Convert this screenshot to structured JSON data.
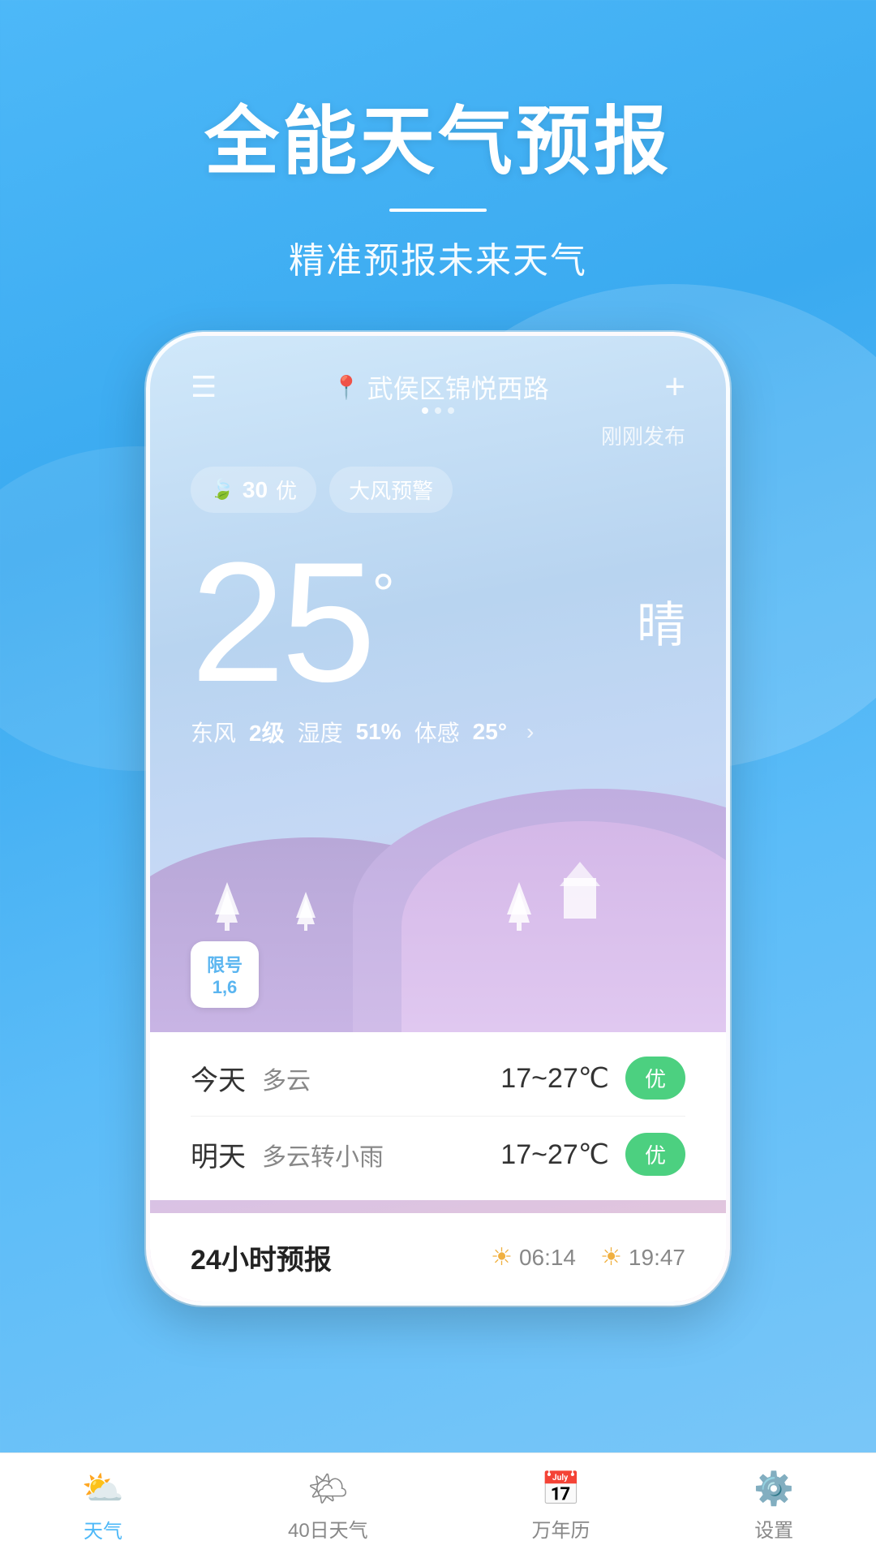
{
  "hero": {
    "title": "全能天气预报",
    "divider": true,
    "subtitle": "精准预报未来天气"
  },
  "phone": {
    "location": "武侯区锦悦西路",
    "published": "刚刚发布",
    "aqi": {
      "number": "30",
      "level": "优"
    },
    "warning": "大风预警",
    "temperature": "25",
    "degree_symbol": "°",
    "condition": "晴",
    "wind": "东风",
    "wind_level": "2级",
    "humidity_label": "湿度",
    "humidity": "51%",
    "feels_like_label": "体感",
    "feels_like": "25°",
    "limit_title": "限号",
    "limit_numbers": "1,6"
  },
  "weather_forecast": {
    "today_label": "今天",
    "today_desc": "多云",
    "today_temp": "17~27℃",
    "today_quality": "优",
    "tomorrow_label": "明天",
    "tomorrow_desc": "多云转小雨",
    "tomorrow_temp": "17~27℃",
    "tomorrow_quality": "优"
  },
  "forecast_24h": {
    "title": "24小时预报",
    "sunrise": "06:14",
    "sunset": "19:47"
  },
  "nav": {
    "items": [
      {
        "label": "天气",
        "active": true
      },
      {
        "label": "40日天气",
        "active": false
      },
      {
        "label": "万年历",
        "active": false
      },
      {
        "label": "设置",
        "active": false
      }
    ]
  }
}
